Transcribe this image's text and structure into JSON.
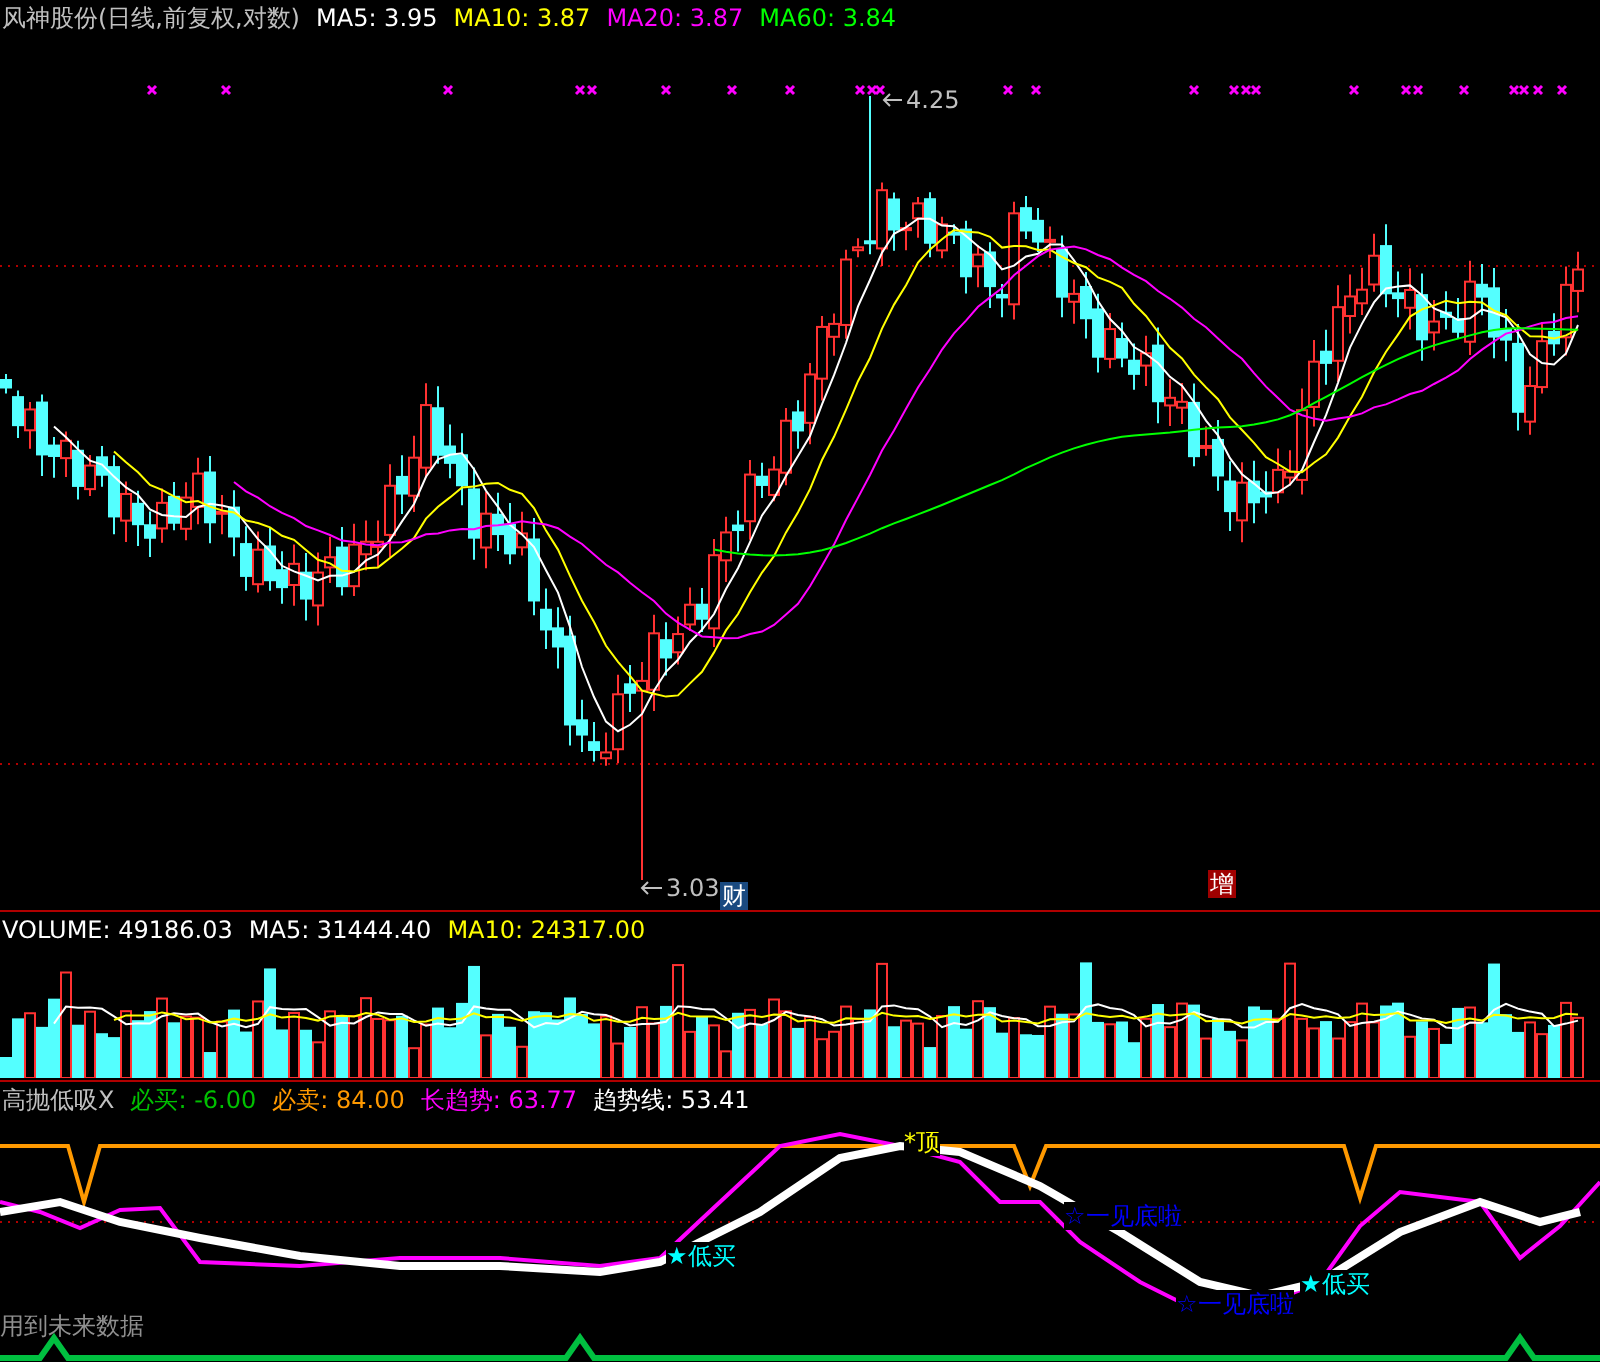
{
  "main_panel": {
    "title": "风神股份(日线,前复权,对数)",
    "indicators": [
      {
        "label": "MA5: 3.95",
        "color": "#ffffff"
      },
      {
        "label": "MA10: 3.87",
        "color": "#ffff00"
      },
      {
        "label": "MA20: 3.87",
        "color": "#ff00ff"
      },
      {
        "label": "MA60: 3.84",
        "color": "#00ff00"
      }
    ],
    "high_label": "4.25",
    "low_label": "3.03",
    "markers": [
      {
        "text": "财",
        "color": "#1a4a80"
      },
      {
        "text": "增",
        "color": "#a00000"
      }
    ]
  },
  "volume_panel": {
    "indicators": [
      {
        "label": "VOLUME: 49186.03",
        "color": "#ffffff"
      },
      {
        "label": "MA5: 31444.40",
        "color": "#ffffff"
      },
      {
        "label": "MA10: 24317.00",
        "color": "#ffff00"
      }
    ]
  },
  "signal_panel": {
    "indicators": [
      {
        "label": "高抛低吸X",
        "color": "#c0c0c0"
      },
      {
        "label": "必买: -6.00",
        "color": "#00c000"
      },
      {
        "label": "必卖: 84.00",
        "color": "#ff9900"
      },
      {
        "label": "长趋势: 63.77",
        "color": "#ff00ff"
      },
      {
        "label": "趋势线: 53.41",
        "color": "#ffffff"
      }
    ],
    "labels": [
      {
        "text": "*顶",
        "color": "#ffff00"
      },
      {
        "text": "☆一见底啦",
        "color": "#0000ff"
      },
      {
        "text": "☆一见底啦",
        "color": "#0000ff"
      },
      {
        "text": "★低买",
        "color": "#00ffff"
      },
      {
        "text": "★低买",
        "color": "#00ffff"
      }
    ],
    "note": "用到未来数据"
  }
}
